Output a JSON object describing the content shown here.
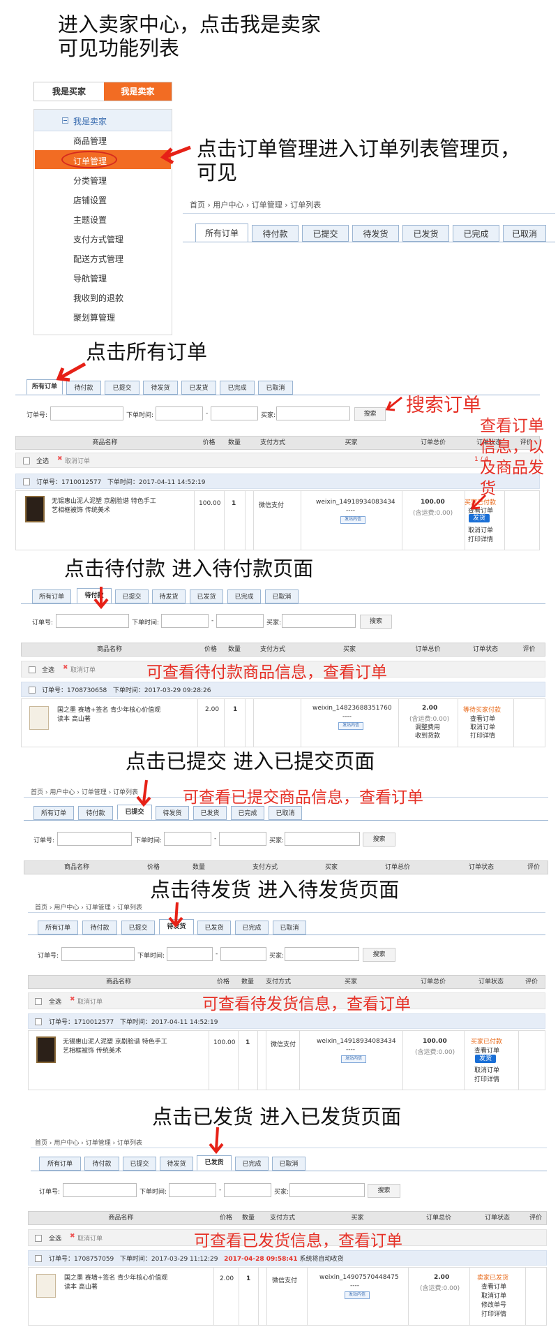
{
  "intro": {
    "line1": "进入卖家中心，点击我是卖家",
    "line2": "可见功能列表"
  },
  "seller": {
    "tab_buyer": "我是买家",
    "tab_seller": "我是卖家",
    "menu_header": "我是卖家",
    "menu_header_icon": "minus-box-icon",
    "items": [
      "商品管理",
      "订单管理",
      "分类管理",
      "店铺设置",
      "主题设置",
      "支付方式管理",
      "配送方式管理",
      "导航管理",
      "我收到的退款",
      "聚划算管理"
    ],
    "active_index": 1
  },
  "colors": {
    "brand": "#f26c23",
    "accent_red": "#e63127",
    "tab_blue": "#eaf1f9",
    "ship_button": "#1a6fd6"
  },
  "ann": {
    "order_mgmt_line1": "点击订单管理进入订单列表管理页，",
    "order_mgmt_line2": "可见",
    "all_orders": "点击所有订单",
    "search_orders": "搜索订单",
    "view_info": "查看订单信息，以及商品发货",
    "s2": "点击待付款  进入待付款页面",
    "s2red": "可查看待付款商品信息，查看订单",
    "s3": "点击已提交  进入已提交页面",
    "s3red": "可查看已提交商品信息，查看订单",
    "s4": "点击待发货  进入待发货页面",
    "s4red": "可查看待发货信息，查看订单",
    "s5": "点击已发货  进入已发货页面",
    "s5red": "可查看已发货信息，查看订单"
  },
  "crumbs": [
    "首页",
    "用户中心",
    "订单管理",
    "订单列表"
  ],
  "tabs": [
    "所有订单",
    "待付款",
    "已提交",
    "待发货",
    "已发货",
    "已完成",
    "已取消"
  ],
  "search": {
    "order_no": "订单号:",
    "time": "下单时间:",
    "dash": "-",
    "buyer": "买家:",
    "btn": "搜索"
  },
  "headers": [
    "商品名称",
    "价格",
    "数量",
    "支付方式",
    "买家",
    "订单总价",
    "订单状态",
    "评价"
  ],
  "headers_sub": [
    "商品名称",
    "价格",
    "数量",
    "支付方式",
    "买家",
    "订单总价",
    "订单状态",
    "评价"
  ],
  "select_all": "全选",
  "cancel_order": "取消订单",
  "cancel_icon": "x-icon",
  "pager": "1 / 4",
  "ordno_label": "订单号：",
  "otime_label": "下单时间：",
  "o1": {
    "no": "1710012577",
    "time": "2017-04-11 14:52:19",
    "prod1": "无锡惠山泥人泥塑 京剧脸谱 特色手工",
    "prod2": "艺相框被饰 传统美术",
    "price": "100.00",
    "qty": "1",
    "pay": "微信支付",
    "buyer": "weixin_14918934083434",
    "buyer_dash": "----",
    "buyer_badge": "发站内信",
    "total": "100.00",
    "freight": "(含运费:0.00)",
    "status": "买家已付款",
    "view": "查看订单",
    "ship": "发货",
    "cancel": "取消订单",
    "print": "打印详情"
  },
  "o2": {
    "no": "1708730658",
    "time": "2017-03-29 09:28:26",
    "prod1": "国之墨 赛墙+签名 青少年核心价值观",
    "prod2": "读本 高山著",
    "price": "2.00",
    "qty": "1",
    "pay": "",
    "buyer": "weixin_14823688351760",
    "buyer_dash": "----",
    "buyer_badge": "发站内信",
    "total": "2.00",
    "freight": "(含运费:0.00)",
    "adjust": "调整费用",
    "receive": "收到货款",
    "status": "等待买家付款",
    "view": "查看订单",
    "cancel": "取消订单",
    "print": "打印详情"
  },
  "o5": {
    "no": "1708757059",
    "time": "2017-03-29 11:12:29",
    "deadline": "2017-04-28 09:58:41",
    "auto": "系统将自动收货",
    "prod1": "国之墨 赛墙+签名 青少年核心价值观",
    "prod2": "读本 高山著",
    "price": "2.00",
    "qty": "1",
    "pay": "微信支付",
    "buyer": "weixin_14907570448475",
    "buyer_dash": "----",
    "buyer_badge": "发站内信",
    "total": "2.00",
    "freight": "(含运费:0.00)",
    "status": "卖家已发货",
    "view": "查看订单",
    "cancel": "取消订单",
    "modify": "修改单号",
    "print": "打印详情"
  }
}
